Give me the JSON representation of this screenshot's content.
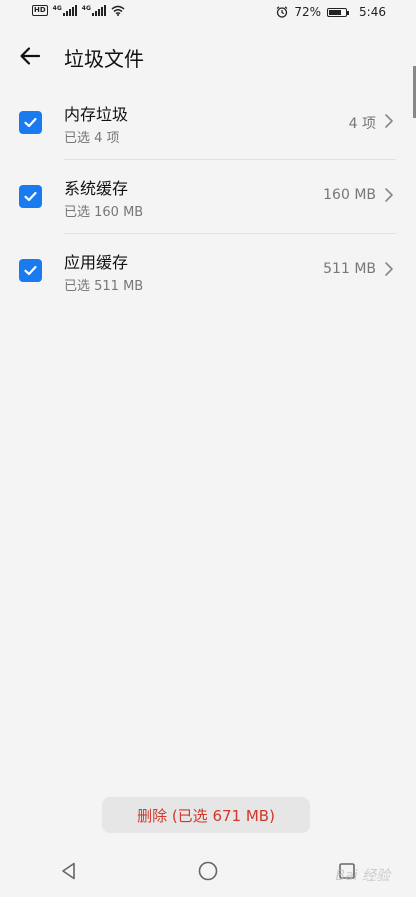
{
  "status_bar": {
    "hd": "HD",
    "net1": "4G",
    "net2": "4G",
    "battery_percent": "72%",
    "battery_level": 0.72,
    "time": "5:46",
    "icons": [
      "hd-icon",
      "signal-icon",
      "signal-icon",
      "wifi-icon",
      "alarm-icon",
      "battery-icon"
    ]
  },
  "header": {
    "title": "垃圾文件",
    "back_icon": "back-arrow-icon"
  },
  "items": [
    {
      "title": "内存垃圾",
      "subtitle": "已选 4 项",
      "value": "4 项",
      "checked": true
    },
    {
      "title": "系统缓存",
      "subtitle": "已选 160 MB",
      "value": "160 MB",
      "checked": true
    },
    {
      "title": "应用缓存",
      "subtitle": "已选 511 MB",
      "value": "511 MB",
      "checked": true
    }
  ],
  "delete_button": {
    "label": "删除 (已选 671 MB)",
    "color": "#d2362b"
  },
  "nav": {
    "icons": [
      "nav-back-icon",
      "nav-home-icon",
      "nav-recent-icon"
    ]
  },
  "watermark": "Bai 经验",
  "colors": {
    "accent": "#1a7bf0",
    "danger": "#d2362b",
    "background": "#f4f4f4"
  }
}
